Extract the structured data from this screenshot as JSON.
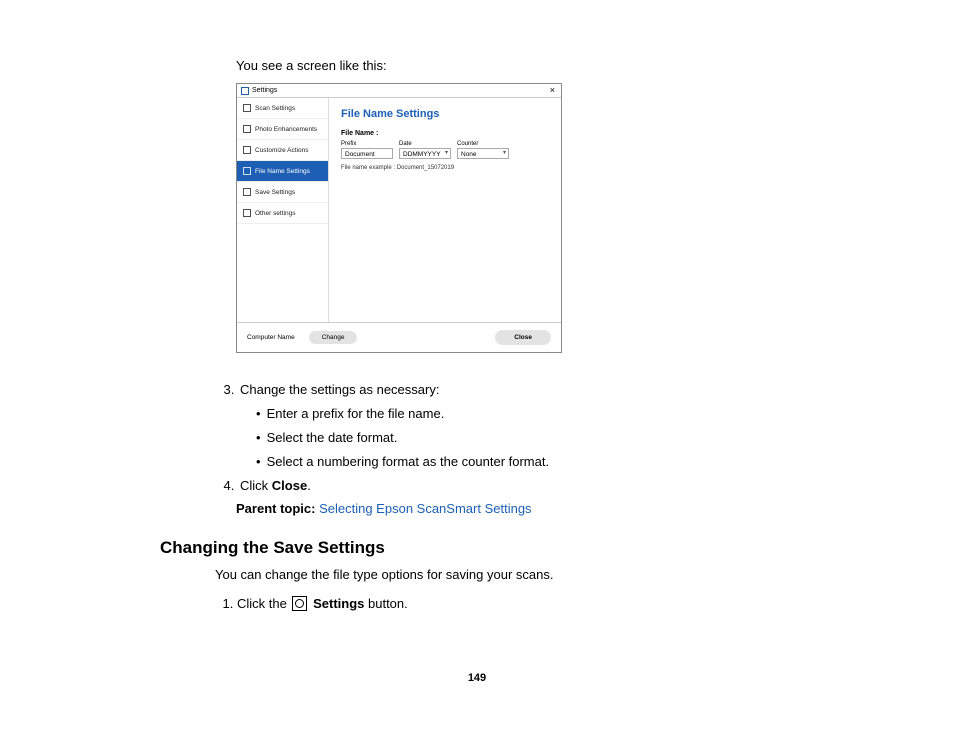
{
  "intro_text": "You see a screen like this:",
  "screenshot": {
    "window_title": "Settings",
    "close_glyph": "×",
    "sidebar": {
      "items": [
        {
          "label": "Scan Settings"
        },
        {
          "label": "Photo Enhancements"
        },
        {
          "label": "Customize Actions"
        },
        {
          "label": "File Name Settings",
          "active": true
        },
        {
          "label": "Save Settings"
        },
        {
          "label": "Other settings"
        }
      ]
    },
    "main": {
      "heading": "File Name Settings",
      "file_name_label": "File Name :",
      "fields": {
        "prefix": {
          "label": "Prefix",
          "value": "Document"
        },
        "date": {
          "label": "Date",
          "value": "DDMMYYYY"
        },
        "counter": {
          "label": "Counter",
          "value": "None"
        }
      },
      "example_text": "File name example : Document_15072019"
    },
    "footer": {
      "computer_name_label": "Computer Name",
      "change_button": "Change",
      "close_button": "Close"
    }
  },
  "steps": {
    "step3_text": "Change the settings as necessary:",
    "step3_bullets": [
      "Enter a prefix for the file name.",
      "Select the date format.",
      "Select a numbering format as the counter format."
    ],
    "step4_prefix": "Click ",
    "step4_bold": "Close",
    "step4_suffix": "."
  },
  "parent_topic_label": "Parent topic:",
  "parent_topic_link": "Selecting Epson ScanSmart Settings",
  "section2": {
    "heading": "Changing the Save Settings",
    "intro": "You can change the file type options for saving your scans.",
    "step1_prefix": "Click the ",
    "step1_bold": "Settings",
    "step1_suffix": " button."
  },
  "page_number": "149"
}
